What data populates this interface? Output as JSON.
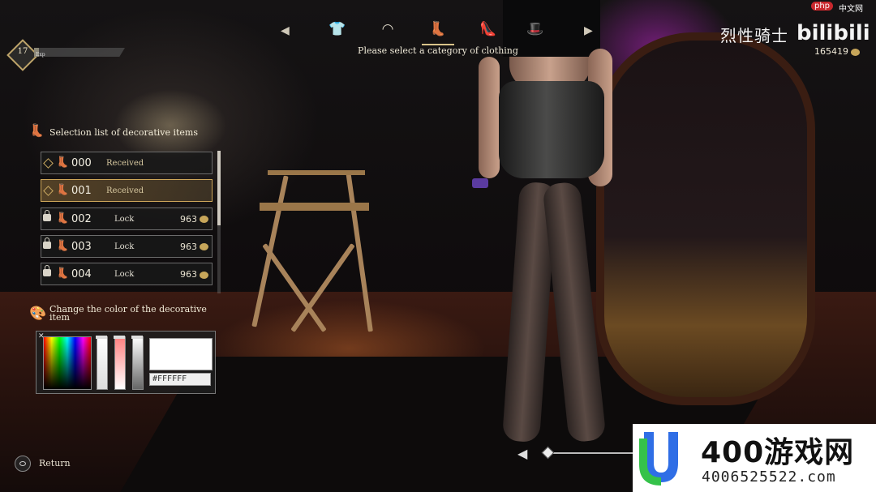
{
  "header": {
    "nav_left_arrow": "◀",
    "nav_right_arrow": "▶",
    "categories": [
      {
        "icon": "shirt-icon",
        "glyph": "👕"
      },
      {
        "icon": "skirt-icon",
        "glyph": "◠"
      },
      {
        "icon": "stocking-icon",
        "glyph": "👢"
      },
      {
        "icon": "heel-shoe-icon",
        "glyph": "👠"
      },
      {
        "icon": "hat-icon",
        "glyph": "🎩"
      }
    ],
    "active_category_index": 2,
    "hint": "Please select a category of clothing"
  },
  "player": {
    "level": "17",
    "exp_label": "Exp",
    "exp_progress": 0.05
  },
  "branding": {
    "cn_title": "烈性骑士",
    "bilibili": "bilibili",
    "php_badge": "php",
    "php_cn": "中文网"
  },
  "currency": {
    "amount": "165419",
    "icon": "coin-icon"
  },
  "decor_list": {
    "title": "Selection list of decorative items",
    "items": [
      {
        "id": "000",
        "status": "Received",
        "price": "",
        "locked": false,
        "selected": false
      },
      {
        "id": "001",
        "status": "Received",
        "price": "",
        "locked": false,
        "selected": true
      },
      {
        "id": "002",
        "status": "Lock",
        "price": "963",
        "locked": true,
        "selected": false
      },
      {
        "id": "003",
        "status": "Lock",
        "price": "963",
        "locked": true,
        "selected": false
      },
      {
        "id": "004",
        "status": "Lock",
        "price": "963",
        "locked": true,
        "selected": false
      }
    ],
    "scroll_fraction": 0.52
  },
  "color_picker": {
    "title_line1": "Change the color of the decorative",
    "title_line2": "item",
    "hex_value": "#FFFFFF",
    "preview_color": "#ffffff",
    "close_glyph": "✕"
  },
  "footer": {
    "return_label": "Return",
    "zoom_arrow": "◀"
  },
  "watermark": {
    "big": "400游戏网",
    "small": "4006525522.com",
    "logo_colors": [
      "#2f6ee6",
      "#35c24a"
    ]
  }
}
